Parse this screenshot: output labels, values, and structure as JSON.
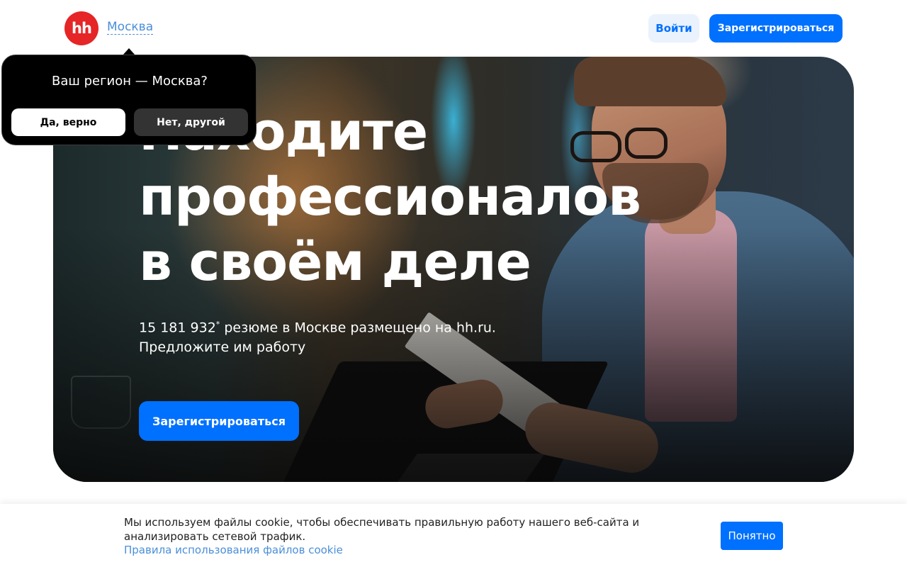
{
  "header": {
    "logo_text": "hh",
    "city": "Москва",
    "login_label": "Войти",
    "register_label": "Зарегистрироваться"
  },
  "region_popup": {
    "question": "Ваш регион — Москва?",
    "yes_label": "Да, верно",
    "no_label": "Нет, другой"
  },
  "hero": {
    "title_line1": "Находите",
    "title_line2": "профессионалов",
    "title_line3": "в своём деле",
    "resume_count": "15 181 932",
    "footnote_mark": "*",
    "subtitle_rest": " резюме в Москве размещено на hh.ru.",
    "subtitle_line2": "Предложите им работу",
    "cta_label": "Зарегистрироваться"
  },
  "cookie": {
    "text": "Мы используем файлы cookie, чтобы обеспечивать правильную работу нашего веб-сайта и анализировать сетевой трафик.",
    "link_label": "Правила использования файлов cookie",
    "ok_label": "Понятно"
  },
  "colors": {
    "brand_red": "#e52526",
    "accent_blue": "#0070ff",
    "link_blue": "#4a8fd9"
  }
}
